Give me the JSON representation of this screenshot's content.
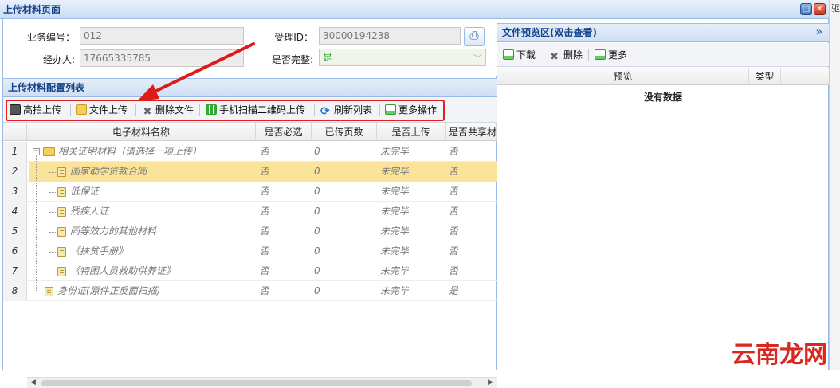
{
  "window": {
    "title": "上传材料页面"
  },
  "edge_text": "驱",
  "form": {
    "business_no_label": "业务编号：",
    "business_no_value": "012",
    "agent_label": "经办人:",
    "agent_value": "17665335785",
    "accept_id_label": "受理ID：",
    "accept_id_value": "30000194238",
    "complete_label": "是否完整:",
    "complete_value": "是"
  },
  "materials": {
    "title": "上传材料配置列表",
    "toolbar": {
      "hd_upload": "高拍上传",
      "file_upload": "文件上传",
      "delete_file": "删除文件",
      "qr_upload": "手机扫描二维码上传",
      "refresh": "刷新列表",
      "more": "更多操作"
    },
    "columns": [
      "电子材料名称",
      "是否必选",
      "已传页数",
      "是否上传",
      "是否共享材"
    ],
    "rows": [
      {
        "n": "1",
        "name": "相关证明材料（请选择一项上传）",
        "required": "否",
        "pages": "0",
        "uploaded": "未完毕",
        "shared": "否"
      },
      {
        "n": "2",
        "name": "国家助学贷款合同",
        "required": "否",
        "pages": "0",
        "uploaded": "未完毕",
        "shared": "否"
      },
      {
        "n": "3",
        "name": "低保证",
        "required": "否",
        "pages": "0",
        "uploaded": "未完毕",
        "shared": "否"
      },
      {
        "n": "4",
        "name": "残疾人证",
        "required": "否",
        "pages": "0",
        "uploaded": "未完毕",
        "shared": "否"
      },
      {
        "n": "5",
        "name": "同等效力的其他材料",
        "required": "否",
        "pages": "0",
        "uploaded": "未完毕",
        "shared": "否"
      },
      {
        "n": "6",
        "name": "《扶贫手册》",
        "required": "否",
        "pages": "0",
        "uploaded": "未完毕",
        "shared": "否"
      },
      {
        "n": "7",
        "name": "《特困人员救助供养证》",
        "required": "否",
        "pages": "0",
        "uploaded": "未完毕",
        "shared": "否"
      },
      {
        "n": "8",
        "name": "身份证(原件正反面扫描)",
        "required": "否",
        "pages": "0",
        "uploaded": "未完毕",
        "shared": "是"
      }
    ]
  },
  "preview": {
    "title": "文件预览区(双击查看)",
    "toolbar": {
      "download": "下载",
      "delete": "删除",
      "more": "更多"
    },
    "columns": [
      "预览",
      "类型"
    ],
    "empty": "没有数据"
  },
  "watermark": "云南龙网"
}
